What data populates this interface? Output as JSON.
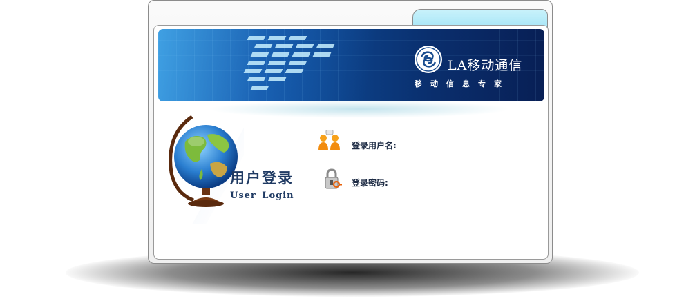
{
  "brand": {
    "name": "LA移动通信",
    "slogan": "移动信息专家"
  },
  "login": {
    "title_cn": "用户登录",
    "title_en": "User  Login",
    "username_label": "登录用户名:",
    "password_label": "登录密码:"
  },
  "icons": {
    "brand_logo": "china-mobile-logo",
    "illustration": "globe-icon",
    "username": "users-icon",
    "password": "padlock-key-icon"
  },
  "colors": {
    "banner_dark": "#081f55",
    "banner_light": "#1f6fc0",
    "tab": "#a8e6f7",
    "title": "#1f3a63"
  }
}
